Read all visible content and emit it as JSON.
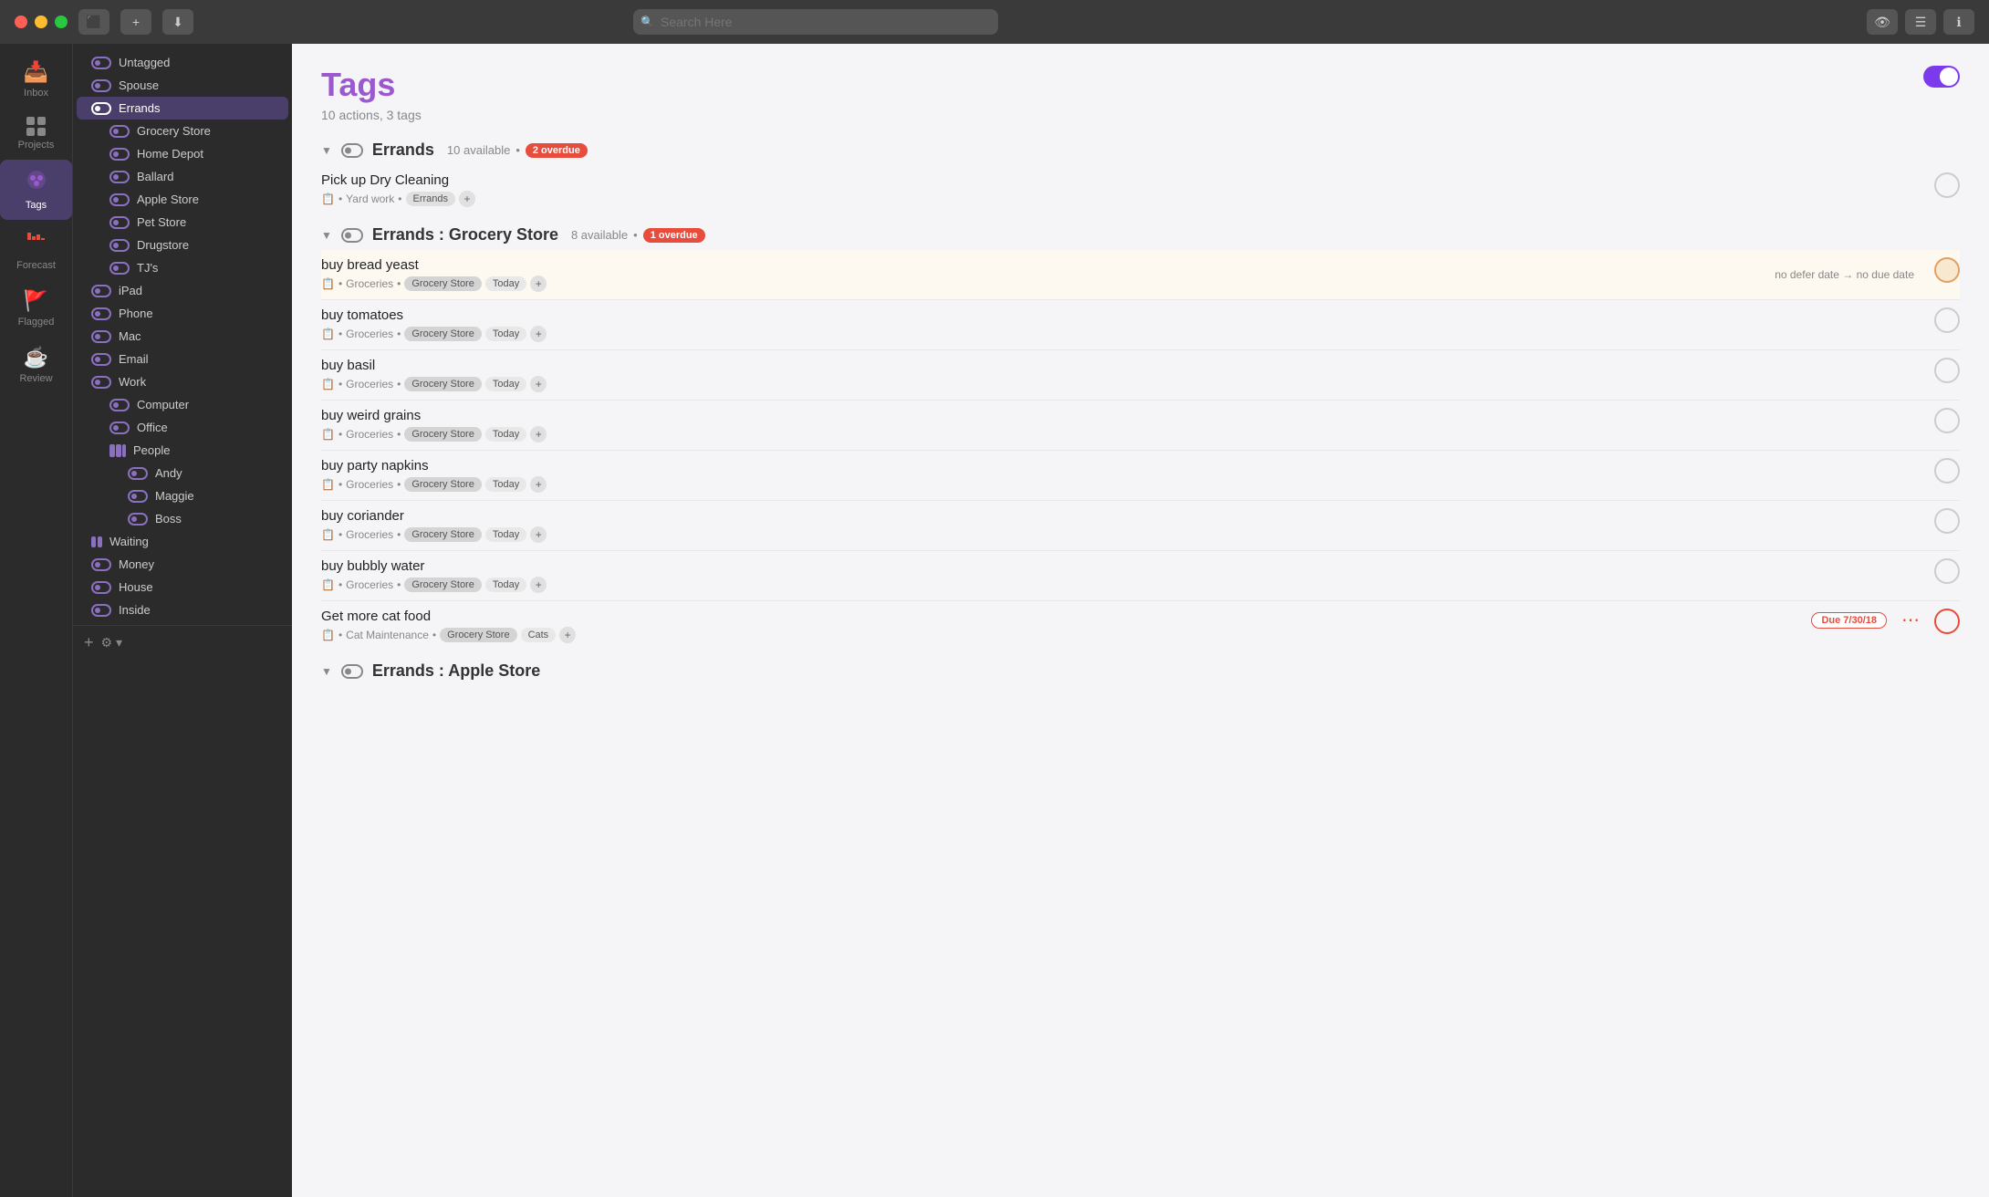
{
  "titlebar": {
    "search_placeholder": "Search Here",
    "btn_back": "◀",
    "btn_new": "+",
    "btn_save": "⬇"
  },
  "nav_rail": {
    "items": [
      {
        "id": "inbox",
        "label": "Inbox",
        "icon": "📥"
      },
      {
        "id": "projects",
        "label": "Projects",
        "icon": "⚫"
      },
      {
        "id": "tags",
        "label": "Tags",
        "icon": "🏷",
        "active": true
      },
      {
        "id": "forecast",
        "label": "Forecast",
        "icon": "🟥"
      },
      {
        "id": "flagged",
        "label": "Flagged",
        "icon": "🚩"
      },
      {
        "id": "review",
        "label": "Review",
        "icon": "☕"
      }
    ]
  },
  "sidebar": {
    "items": [
      {
        "id": "untagged",
        "label": "Untagged",
        "indent": 0,
        "icon": "tag"
      },
      {
        "id": "spouse",
        "label": "Spouse",
        "indent": 0,
        "icon": "tag"
      },
      {
        "id": "errands",
        "label": "Errands",
        "indent": 0,
        "icon": "tag",
        "active": true
      },
      {
        "id": "grocery-store",
        "label": "Grocery Store",
        "indent": 1,
        "icon": "tag"
      },
      {
        "id": "home-depot",
        "label": "Home Depot",
        "indent": 1,
        "icon": "tag"
      },
      {
        "id": "ballard",
        "label": "Ballard",
        "indent": 1,
        "icon": "tag"
      },
      {
        "id": "apple-store",
        "label": "Apple Store",
        "indent": 1,
        "icon": "tag"
      },
      {
        "id": "pet-store",
        "label": "Pet Store",
        "indent": 1,
        "icon": "tag"
      },
      {
        "id": "drugstore",
        "label": "Drugstore",
        "indent": 1,
        "icon": "tag"
      },
      {
        "id": "tjs",
        "label": "TJ's",
        "indent": 1,
        "icon": "tag"
      },
      {
        "id": "ipad",
        "label": "iPad",
        "indent": 0,
        "icon": "tag"
      },
      {
        "id": "phone",
        "label": "Phone",
        "indent": 0,
        "icon": "tag"
      },
      {
        "id": "mac",
        "label": "Mac",
        "indent": 0,
        "icon": "tag"
      },
      {
        "id": "email",
        "label": "Email",
        "indent": 0,
        "icon": "tag"
      },
      {
        "id": "work",
        "label": "Work",
        "indent": 0,
        "icon": "tag"
      },
      {
        "id": "computer",
        "label": "Computer",
        "indent": 1,
        "icon": "tag"
      },
      {
        "id": "office",
        "label": "Office",
        "indent": 1,
        "icon": "tag"
      },
      {
        "id": "people",
        "label": "People",
        "indent": 1,
        "icon": "tag-progress"
      },
      {
        "id": "andy",
        "label": "Andy",
        "indent": 2,
        "icon": "tag"
      },
      {
        "id": "maggie",
        "label": "Maggie",
        "indent": 2,
        "icon": "tag"
      },
      {
        "id": "boss",
        "label": "Boss",
        "indent": 2,
        "icon": "tag"
      },
      {
        "id": "waiting",
        "label": "Waiting",
        "indent": 0,
        "icon": "progress"
      },
      {
        "id": "money",
        "label": "Money",
        "indent": 0,
        "icon": "tag"
      },
      {
        "id": "house",
        "label": "House",
        "indent": 0,
        "icon": "tag"
      },
      {
        "id": "inside",
        "label": "Inside",
        "indent": 0,
        "icon": "tag"
      }
    ],
    "add_label": "+",
    "settings_label": "⚙ ▾"
  },
  "content": {
    "title": "Tags",
    "subtitle": "10 actions, 3 tags",
    "toggle_on": true,
    "sections": [
      {
        "id": "errands",
        "title": "Errands",
        "available": "10 available",
        "overdue_count": "2 overdue",
        "overdue_style": "filled",
        "tasks": [
          {
            "id": "t1",
            "title": "Pick up Dry Cleaning",
            "meta_project": "Yard work",
            "meta_tag": "Errands",
            "highlighted": false,
            "overdue": false
          }
        ]
      },
      {
        "id": "errands-grocery",
        "title": "Errands : Grocery Store",
        "available": "8 available",
        "overdue_count": "1 overdue",
        "overdue_style": "filled",
        "tasks": [
          {
            "id": "t2",
            "title": "buy bread yeast",
            "meta_project": "Groceries",
            "meta_tag": "Grocery Store",
            "meta_when": "Today",
            "highlighted": true,
            "hint": "no defer date → no due date",
            "overdue": false
          },
          {
            "id": "t3",
            "title": "buy tomatoes",
            "meta_project": "Groceries",
            "meta_tag": "Grocery Store",
            "meta_when": "Today",
            "highlighted": false,
            "overdue": false
          },
          {
            "id": "t4",
            "title": "buy basil",
            "meta_project": "Groceries",
            "meta_tag": "Grocery Store",
            "meta_when": "Today",
            "highlighted": false,
            "overdue": false
          },
          {
            "id": "t5",
            "title": "buy weird grains",
            "meta_project": "Groceries",
            "meta_tag": "Grocery Store",
            "meta_when": "Today",
            "highlighted": false,
            "overdue": false
          },
          {
            "id": "t6",
            "title": "buy party napkins",
            "meta_project": "Groceries",
            "meta_tag": "Grocery Store",
            "meta_when": "Today",
            "highlighted": false,
            "overdue": false
          },
          {
            "id": "t7",
            "title": "buy coriander",
            "meta_project": "Groceries",
            "meta_tag": "Grocery Store",
            "meta_when": "Today",
            "highlighted": false,
            "overdue": false
          },
          {
            "id": "t8",
            "title": "buy bubbly water",
            "meta_project": "Groceries",
            "meta_tag": "Grocery Store",
            "meta_when": "Today",
            "highlighted": false,
            "overdue": false
          },
          {
            "id": "t9",
            "title": "Get more cat food",
            "meta_project": "Cat Maintenance",
            "meta_tag": "Grocery Store",
            "meta_tag2": "Cats",
            "highlighted": false,
            "overdue": true,
            "due_label": "Due 7/30/18"
          }
        ]
      },
      {
        "id": "errands-apple",
        "title": "Errands : Apple Store",
        "available": "",
        "overdue_count": "",
        "tasks": []
      }
    ]
  }
}
